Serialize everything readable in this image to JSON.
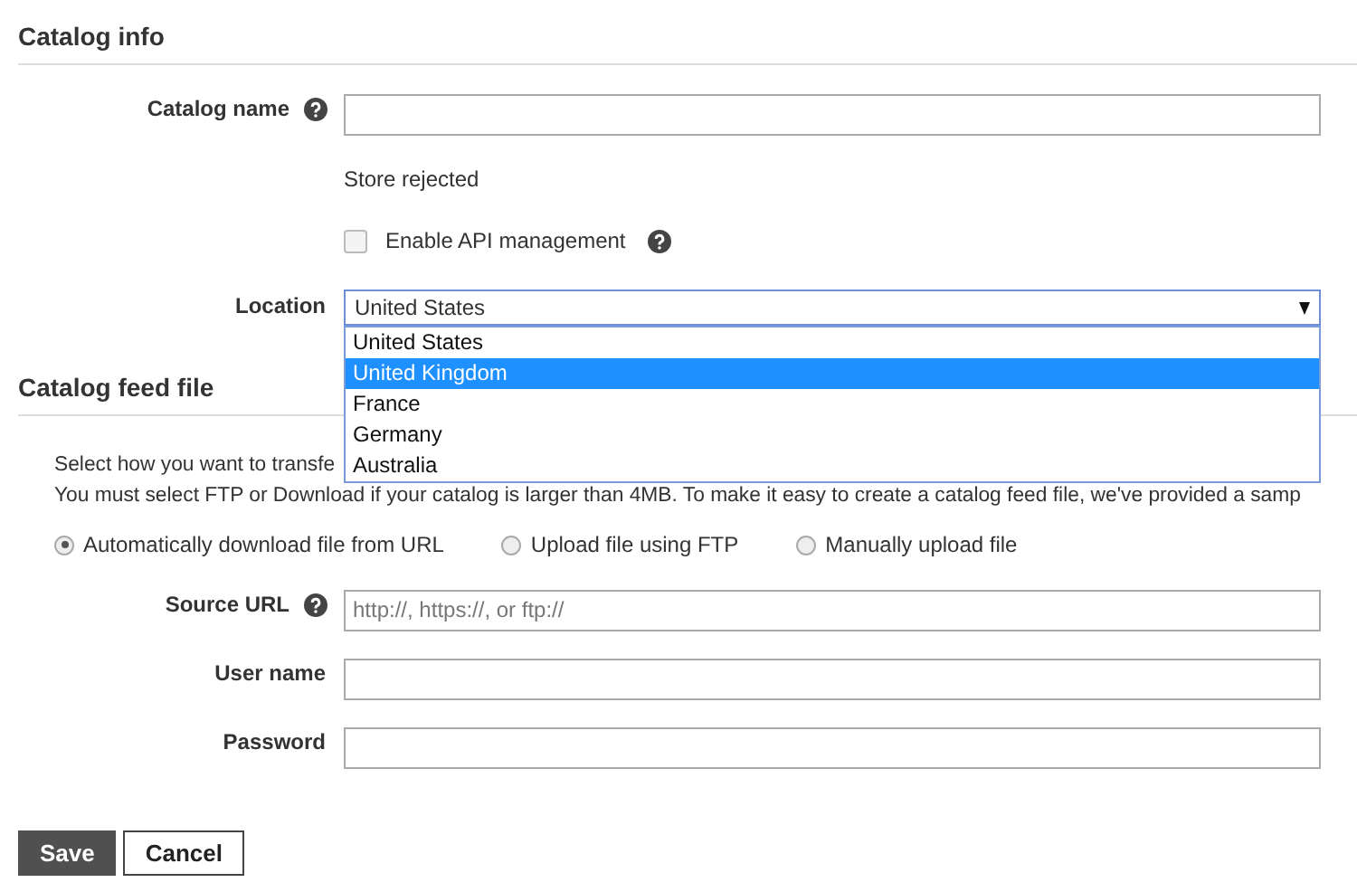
{
  "sections": [
    {
      "title": "Catalog info",
      "rows": [
        {
          "kind": "field",
          "label": "Catalog name",
          "help": true,
          "value": ""
        },
        {
          "kind": "note",
          "text": "Store rejected"
        },
        {
          "kind": "checkbox",
          "label": "Enable API management",
          "help": true,
          "checked": false
        },
        {
          "kind": "select",
          "label": "Location",
          "value": "United States",
          "expanded": true,
          "options": [
            {
              "label": "United States",
              "highlighted": false
            },
            {
              "label": "United Kingdom",
              "highlighted": true
            },
            {
              "label": "France",
              "highlighted": false
            },
            {
              "label": "Germany",
              "highlighted": false
            },
            {
              "label": "Australia",
              "highlighted": false
            }
          ]
        }
      ]
    },
    {
      "title": "Catalog feed file",
      "intro": [
        "Select how you want to transfe",
        "You must select FTP or Download if your catalog is larger than 4MB. To make it easy to create a catalog feed file, we've provided a samp"
      ],
      "radios": [
        {
          "label": "Automatically download file from URL",
          "selected": true
        },
        {
          "label": "Upload file using FTP",
          "selected": false
        },
        {
          "label": "Manually upload file",
          "selected": false
        }
      ],
      "rows": [
        {
          "kind": "field",
          "label": "Source URL",
          "help": true,
          "placeholder": "http://, https://, or ftp://"
        },
        {
          "kind": "field",
          "label": "User name",
          "help": false,
          "value": ""
        },
        {
          "kind": "field",
          "label": "Password",
          "help": false,
          "value": ""
        }
      ]
    }
  ],
  "buttons": [
    {
      "label": "Save",
      "kind": "primary"
    },
    {
      "label": "Cancel",
      "kind": "secondary"
    }
  ]
}
